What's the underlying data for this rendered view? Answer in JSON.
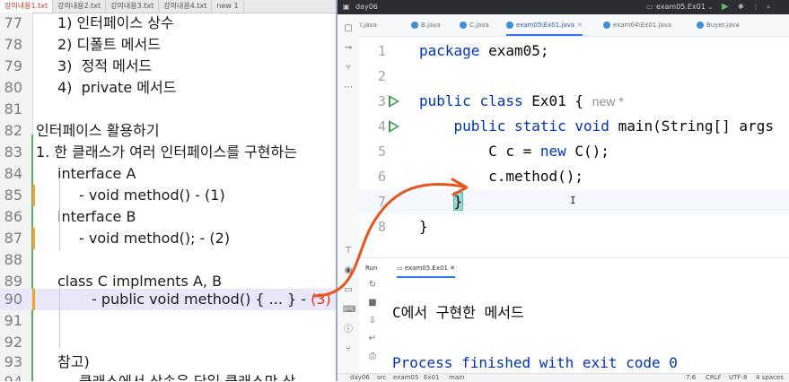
{
  "left_editor": {
    "tabs": [
      "강의내용1.txt",
      "강의내용2.txt",
      "강의내용3.txt",
      "강의내용4.txt",
      "new 1"
    ],
    "lines": [
      {
        "num": "77",
        "text": "1) 인터페이스 상수"
      },
      {
        "num": "78",
        "text": "2) 디폴트 메서드"
      },
      {
        "num": "79",
        "text": "3)  정적 메서드"
      },
      {
        "num": "80",
        "text": "4)  private 메서드"
      },
      {
        "num": "81",
        "text": ""
      },
      {
        "num": "82",
        "text": "인터페이스 활용하기"
      },
      {
        "num": "83",
        "text": "1. 한 클래스가 여러 인터페이스를 구현하는"
      },
      {
        "num": "84",
        "text": "interface A"
      },
      {
        "num": "85",
        "text": "- void method() - (1)"
      },
      {
        "num": "86",
        "text": "interface B"
      },
      {
        "num": "87",
        "text": "- void method(); - (2)"
      },
      {
        "num": "88",
        "text": ""
      },
      {
        "num": "89",
        "text": "class C implments A, B"
      },
      {
        "num": "90",
        "text_prefix": "- public void method() { ... } - ",
        "text_red": "(3)"
      },
      {
        "num": "91",
        "text": ""
      },
      {
        "num": "92",
        "text": ""
      },
      {
        "num": "93",
        "text": "참고)"
      },
      {
        "num": "94",
        "text": "클래스에서 상속은 단일 클래스만 상"
      }
    ]
  },
  "ide": {
    "project": "day06",
    "run_config": "exam05.Ex01",
    "tabs": [
      "I.java",
      "B.java",
      "C.java",
      "exam05\\Ex01.java",
      "exam04\\Ex01.java",
      "Buyer.java"
    ],
    "active_tab_index": 3,
    "code_lines": [
      {
        "num": "1",
        "tokens": [
          {
            "t": "package",
            "k": true
          },
          {
            "t": " exam05;"
          }
        ]
      },
      {
        "num": "2",
        "tokens": []
      },
      {
        "num": "3",
        "tokens": [
          {
            "t": "public",
            "k": true
          },
          {
            "t": " "
          },
          {
            "t": "class",
            "k": true
          },
          {
            "t": " Ex01 { "
          },
          {
            "t": "new *",
            "h": true
          }
        ]
      },
      {
        "num": "4",
        "tokens": [
          {
            "t": "    "
          },
          {
            "t": "public",
            "k": true
          },
          {
            "t": " "
          },
          {
            "t": "static",
            "k": true
          },
          {
            "t": " "
          },
          {
            "t": "void",
            "k": true
          },
          {
            "t": " main(String[] args"
          }
        ]
      },
      {
        "num": "5",
        "tokens": [
          {
            "t": "        C c = "
          },
          {
            "t": "new",
            "k": true
          },
          {
            "t": " C();"
          }
        ]
      },
      {
        "num": "6",
        "tokens": [
          {
            "t": "        c.method();"
          }
        ]
      },
      {
        "num": "7",
        "tokens": [
          {
            "t": "    "
          },
          {
            "t": "}",
            "b": true
          }
        ]
      },
      {
        "num": "8",
        "tokens": [
          {
            "t": "}"
          }
        ]
      }
    ],
    "run_tab_label": "Run",
    "run_tab_title": "exam05.Ex01",
    "output_lines": [
      "C에서 구현한 메서드",
      "",
      "Process finished with exit code 0"
    ],
    "status": {
      "breadcrumb": [
        "day06",
        "src",
        "exam05",
        "Ex01",
        "main"
      ],
      "position": "7:6",
      "line_sep": "CRLF",
      "encoding": "UTF-8",
      "indent": "4 spaces"
    }
  },
  "colors": {
    "keyword": "#0033b3",
    "annotation": "#e8541c",
    "run_arrow": "#3e9b4f",
    "left_highlight": "#e8e8fa"
  },
  "icons": {
    "sidebar": [
      "folder-icon",
      "commit-icon",
      "branch-icon",
      "more-icon",
      "build-icon",
      "run-icon",
      "terminal-icon",
      "problems-icon",
      "git-icon"
    ]
  }
}
